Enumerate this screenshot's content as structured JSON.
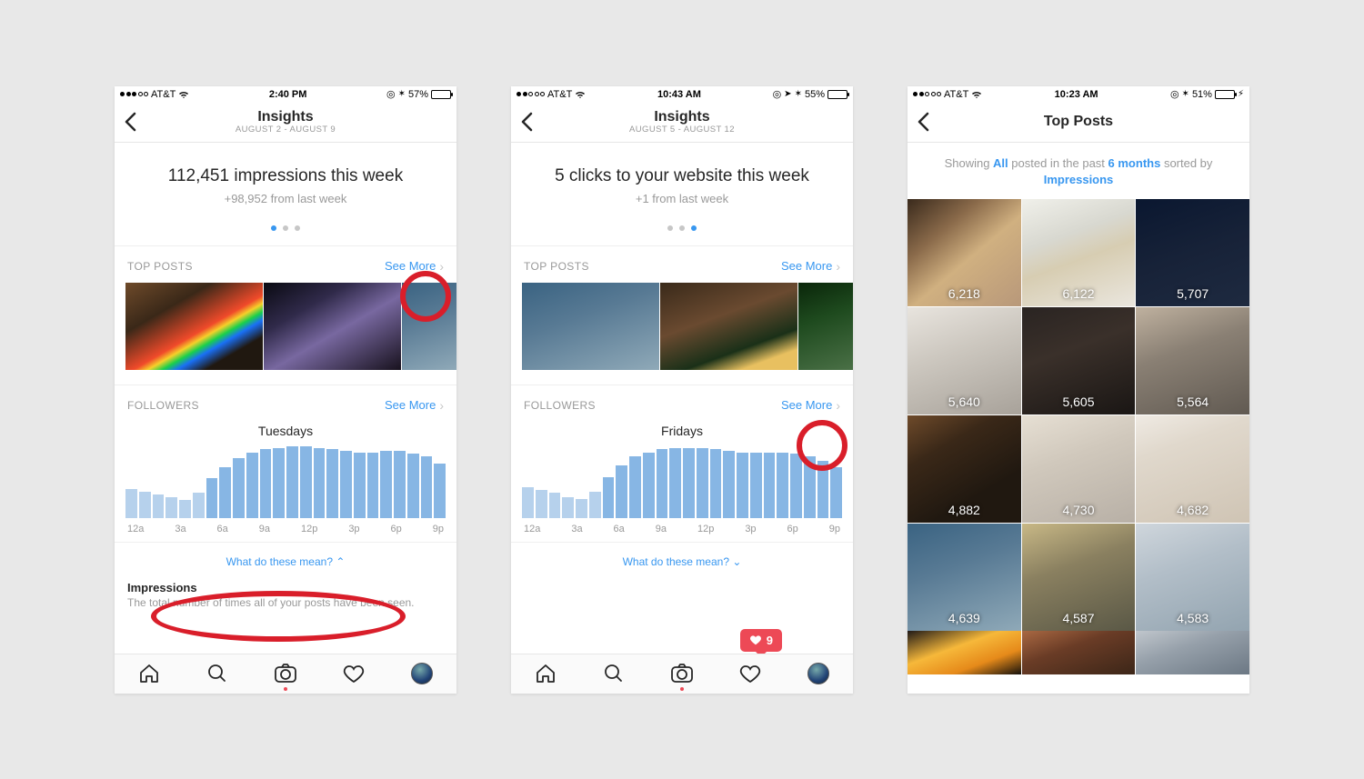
{
  "screens": [
    {
      "status": {
        "carrier": "AT&T",
        "time": "2:40 PM",
        "battery": "57%",
        "signal_full": 3,
        "signal_empty": 2,
        "icons_right": [
          "compass",
          "bt"
        ],
        "charging": false
      },
      "header": {
        "title": "Insights",
        "sub": "AUGUST 2 - AUGUST 9"
      },
      "hero": {
        "main": "112,451 impressions this week",
        "sub": "+98,952 from last week",
        "active": 0,
        "dots": 3
      },
      "top_posts": {
        "label": "TOP POSTS",
        "cta": "See More"
      },
      "followers": {
        "label": "FOLLOWERS",
        "cta": "See More",
        "day": "Tuesdays"
      },
      "what_mean": "What do these mean?",
      "definition": {
        "title": "Impressions",
        "body": "The total number of times all of your posts have been seen."
      }
    },
    {
      "status": {
        "carrier": "AT&T",
        "time": "10:43 AM",
        "battery": "55%",
        "signal_full": 2,
        "signal_empty": 3,
        "icons_right": [
          "compass",
          "nav",
          "bt"
        ],
        "charging": false
      },
      "header": {
        "title": "Insights",
        "sub": "AUGUST 5 - AUGUST 12"
      },
      "hero": {
        "main": "5 clicks to your website this week",
        "sub": "+1 from last week",
        "active": 2,
        "dots": 3
      },
      "top_posts": {
        "label": "TOP POSTS",
        "cta": "See More"
      },
      "followers": {
        "label": "FOLLOWERS",
        "cta": "See More",
        "day": "Fridays"
      },
      "what_mean": "What do these mean?",
      "heart_count": "9"
    },
    {
      "status": {
        "carrier": "AT&T",
        "time": "10:23 AM",
        "battery": "51%",
        "signal_full": 2,
        "signal_empty": 3,
        "icons_right": [
          "compass",
          "bt"
        ],
        "charging": true
      },
      "header": {
        "title": "Top Posts"
      },
      "filter": {
        "pre": "Showing ",
        "a": "All",
        "mid": " posted in the past ",
        "b": "6 months",
        "post": " sorted by ",
        "c": "Impressions"
      },
      "grid_counts": [
        "6,218",
        "6,122",
        "5,707",
        "5,640",
        "5,605",
        "5,564",
        "4,882",
        "4,730",
        "4,682",
        "4,639",
        "4,587",
        "4,583"
      ]
    }
  ],
  "chart_data": [
    {
      "type": "bar",
      "title": "Tuesdays",
      "ylim": [
        0,
        100
      ],
      "x_ticks": [
        "12a",
        "3a",
        "6a",
        "9a",
        "12p",
        "3p",
        "6p",
        "9p"
      ],
      "values": [
        40,
        36,
        32,
        28,
        25,
        35,
        55,
        70,
        82,
        90,
        94,
        96,
        98,
        98,
        96,
        94,
        92,
        90,
        90,
        92,
        92,
        88,
        84,
        74
      ]
    },
    {
      "type": "bar",
      "title": "Fridays",
      "ylim": [
        0,
        100
      ],
      "x_ticks": [
        "12a",
        "3a",
        "6a",
        "9a",
        "12p",
        "3p",
        "6p",
        "9p"
      ],
      "values": [
        42,
        38,
        34,
        28,
        26,
        36,
        56,
        72,
        84,
        90,
        94,
        96,
        96,
        96,
        94,
        92,
        90,
        90,
        90,
        90,
        88,
        84,
        78,
        70
      ]
    }
  ]
}
